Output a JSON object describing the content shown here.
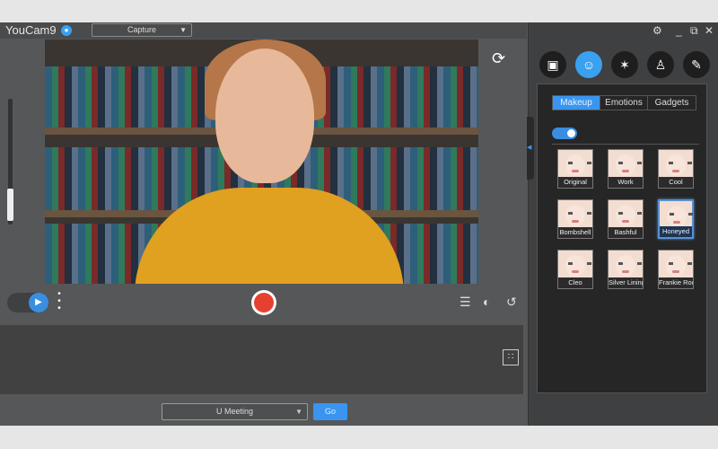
{
  "app": {
    "title": "YouCam9",
    "mode": "Capture"
  },
  "controls": {
    "meeting_app": "U Meeting",
    "go_label": "Go"
  },
  "right_panel": {
    "categories": [
      "frames",
      "effects-face",
      "particles",
      "avatar",
      "brush"
    ],
    "tabs": [
      "Makeup",
      "Emotions",
      "Gadgets"
    ],
    "active_tab": "Makeup",
    "makeup_enabled": true,
    "looks": [
      "Original",
      "Work",
      "Cool",
      "Bombshell",
      "Bashful",
      "Honeyed",
      "Cleo",
      "Silver Lining",
      "Frankie Roc"
    ],
    "selected_look": "Honeyed"
  },
  "colors": {
    "accent": "#3a95f0",
    "record": "#e84030"
  }
}
